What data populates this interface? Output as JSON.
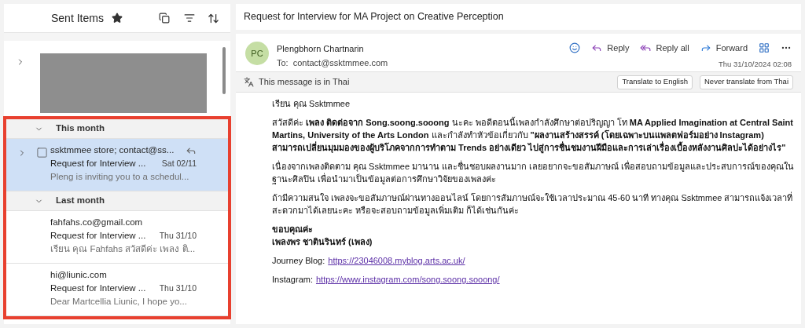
{
  "folder": {
    "title": "Sent Items",
    "favorite": true
  },
  "list": {
    "groups": [
      {
        "label": "This month",
        "expanded": true,
        "items": [
          {
            "sender": "ssktmmee store; contact@ss...",
            "subject": "Request for Interview ...",
            "date": "Sat 02/11",
            "preview": "Pleng is inviting you to a schedul...",
            "selected": true,
            "replied": true
          }
        ]
      },
      {
        "label": "Last month",
        "expanded": true,
        "items": [
          {
            "sender": "fahfahs.co@gmail.com",
            "subject": "Request for Interview ...",
            "date": "Thu 31/10",
            "preview": "เรียน คุณ Fahfahs สวัสดีค่ะ เพลง ติ...",
            "selected": false,
            "replied": false
          },
          {
            "sender": "hi@liunic.com",
            "subject": "Request for Interview ...",
            "date": "Thu 31/10",
            "preview": "Dear Martcellia Liunic, I hope yo...",
            "selected": false,
            "replied": false
          }
        ]
      }
    ]
  },
  "message": {
    "subject": "Request for Interview for MA Project on Creative Perception",
    "avatar": "PC",
    "sender": "Plengbhorn Chartnarin",
    "to_label": "To:",
    "to": "contact@ssktmmee.com",
    "date": "Thu 31/10/2024 02:08",
    "actions": [
      "Reply",
      "Reply all",
      "Forward"
    ],
    "translate": {
      "notice": "This message is in Thai",
      "buttons": [
        "Translate to English",
        "Never translate from Thai"
      ]
    },
    "body": [
      {
        "kind": "text",
        "text": "เรียน คุณ Ssktmmee"
      },
      {
        "kind": "text",
        "text": "สวัสดีค่ะ **เพลง ติดต่อจาก Song.soong.sooong** นะคะ พอดีตอนนี้เพลงกำลังศึกษาต่อปริญญา โท **MA Applied Imagination at Central Saint Martins, University of the Arts London** และกำลังทำหัวข้อเกี่ยวกับ **\"ผลงานสร้างสรรค์ (โดยเฉพาะบนแพลตฟอร์มอย่าง Instagram) สามารถเปลี่ยนมุมมองของผู้บริโภคจากการทำตาม Trends อย่างเดียว ไปสู่การชื่นชมงานฝีมือและการเล่าเรื่องเบื้องหลังงานศิลปะได้อย่างไร\"**"
      },
      {
        "kind": "text",
        "text": "เนื่องจากเพลงติดตาม คุณ Ssktmmee มานาน และชื่นชอบผลงานมาก เลยอยากจะขอสัมภาษณ์ เพื่อสอบถามข้อมูลและประสบการณ์ของคุณในฐานะศิลปิน เพื่อนำมาเป็นข้อมูลต่อการศึกษาวิจัยของเพลงค่ะ"
      },
      {
        "kind": "text",
        "text": "ถ้ามีความสนใจ เพลงจะขอสัมภาษณ์ผ่านทางออนไลน์ โดยการสัมภาษณ์จะใช้เวลาประมาณ 45-60 นาที ทางคุณ Ssktmmee สามารถแจ้งเวลาที่สะดวกมาได้เลยนะคะ หรือจะสอบถามข้อมูลเพิ่มเติม ก็ได้เช่นกันค่ะ"
      },
      {
        "kind": "signature",
        "lines": [
          "ขอบคุณค่ะ",
          "เพลงพร ชาตินรินทร์ (เพลง)"
        ]
      },
      {
        "kind": "link",
        "label": "Journey Blog:",
        "url": "https://23046008.myblog.arts.ac.uk/"
      },
      {
        "kind": "link",
        "label": "Instagram:",
        "url": "https://www.instagram.com/song.soong.sooong/"
      }
    ]
  }
}
